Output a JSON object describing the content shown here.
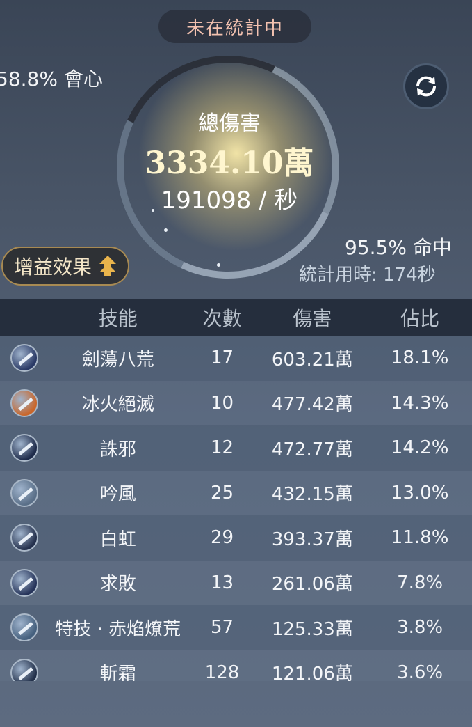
{
  "status": {
    "label": "未在統計中"
  },
  "stats": {
    "crit": "58.8% 會心",
    "hit": "95.5% 命中",
    "timer": "統計用時: 174秒"
  },
  "total": {
    "label": "總傷害",
    "value": "3334.10萬",
    "dps": "191098 / 秒"
  },
  "buff_button": {
    "label": "增益效果"
  },
  "table": {
    "headers": {
      "skill": "技能",
      "count": "次數",
      "damage": "傷害",
      "share": "佔比"
    },
    "rows": [
      {
        "icon": "sword-slash-icon",
        "icon_color": "#2a3a66",
        "name": "劍蕩八荒",
        "count": "17",
        "damage": "603.21萬",
        "share": "18.1%"
      },
      {
        "icon": "fire-ice-wing-icon",
        "icon_color": "#c9662a",
        "name": "冰火絕滅",
        "count": "10",
        "damage": "477.42萬",
        "share": "14.3%"
      },
      {
        "icon": "swordsman-figure-icon",
        "icon_color": "#1e2b4a",
        "name": "誅邪",
        "count": "12",
        "damage": "472.77萬",
        "share": "14.2%"
      },
      {
        "icon": "wind-blade-icon",
        "icon_color": "#5a6f88",
        "name": "吟風",
        "count": "25",
        "damage": "432.15萬",
        "share": "13.0%"
      },
      {
        "icon": "white-rainbow-blade-icon",
        "icon_color": "#24304c",
        "name": "白虹",
        "count": "29",
        "damage": "393.37萬",
        "share": "11.8%"
      },
      {
        "icon": "sword-thrust-icon",
        "icon_color": "#26345a",
        "name": "求敗",
        "count": "13",
        "damage": "261.06萬",
        "share": "7.8%"
      },
      {
        "icon": "blazing-wind-icon",
        "icon_color": "#45607e",
        "name": "特技 · 赤焰燎荒",
        "count": "57",
        "damage": "125.33萬",
        "share": "3.8%"
      },
      {
        "icon": "frost-slash-icon",
        "icon_color": "#22304a",
        "name": "斬霜",
        "count": "128",
        "damage": "121.06萬",
        "share": "3.6%"
      }
    ]
  }
}
